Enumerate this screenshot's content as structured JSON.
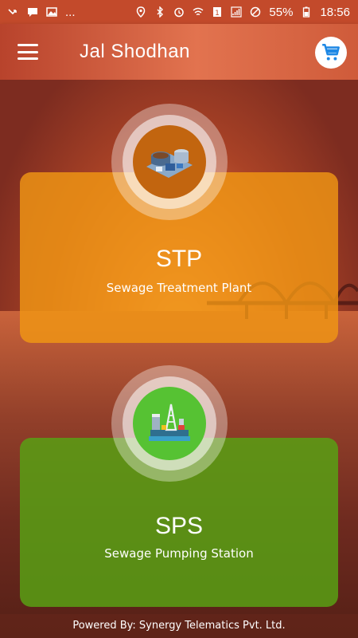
{
  "status_bar": {
    "battery": "55%",
    "time": "18:56",
    "dots": "..."
  },
  "app_bar": {
    "title": "Jal Shodhan",
    "menu_icon": "hamburger-menu-icon",
    "cart_icon": "shopping-cart-icon",
    "cart_color": "#1e88e5"
  },
  "cards": {
    "stp": {
      "title": "STP",
      "subtitle": "Sewage Treatment Plant",
      "color": "#f0961a",
      "icon": "treatment-plant-icon"
    },
    "sps": {
      "title": "SPS",
      "subtitle": "Sewage Pumping Station",
      "color": "#58a014",
      "icon": "pumping-station-icon"
    }
  },
  "footer": {
    "text": "Powered By: Synergy Telematics Pvt. Ltd."
  }
}
